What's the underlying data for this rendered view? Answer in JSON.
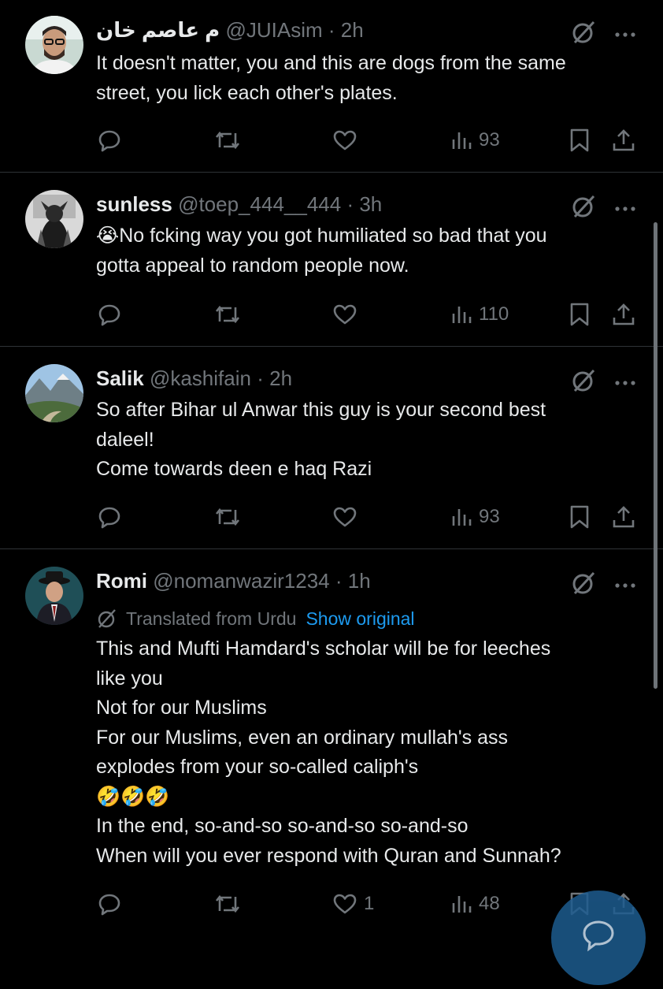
{
  "tweets": [
    {
      "name": "م عاصم خان",
      "handle": "@JUIAsim",
      "time": "2h",
      "lines": [
        "It doesn't matter, you and this are dogs from the same",
        "street, you lick each other's plates."
      ],
      "views": "93",
      "likes": ""
    },
    {
      "name": "sunless",
      "handle": "@toep_444__444",
      "time": "3h",
      "lines": [
        "😭No fcking way you got humiliated so bad that you",
        "gotta appeal to random people now."
      ],
      "views": "110",
      "likes": ""
    },
    {
      "name": "Salik",
      "handle": "@kashifain",
      "time": "2h",
      "lines": [
        "So after Bihar ul Anwar this guy is your second best",
        "daleel!",
        "Come towards deen e haq Razi"
      ],
      "views": "93",
      "likes": ""
    },
    {
      "name": "Romi",
      "handle": "@nomanwazir1234",
      "time": "1h",
      "translated_label": "Translated from Urdu",
      "show_original": "Show original",
      "lines": [
        "This and Mufti Hamdard's scholar will be for leeches",
        "like you",
        "Not for our Muslims",
        "For our Muslims, even an ordinary mullah's ass",
        "explodes from your so-called caliph's",
        "🤣🤣🤣",
        "In the end, so-and-so so-and-so so-and-so",
        "When will you ever respond with Quran and Sunnah?"
      ],
      "views": "48",
      "likes": "1"
    }
  ],
  "icons": {
    "reply": "reply-icon",
    "retweet": "retweet-icon",
    "like": "heart-icon",
    "views": "views-icon",
    "bookmark": "bookmark-icon",
    "share": "share-icon",
    "grok": "grok-icon",
    "more": "more-icon",
    "compose": "compose-icon"
  },
  "colors": {
    "background": "#000000",
    "text": "#e7e9ea",
    "muted": "#71767b",
    "link": "#1d9bf0",
    "divider": "#2f3336"
  }
}
